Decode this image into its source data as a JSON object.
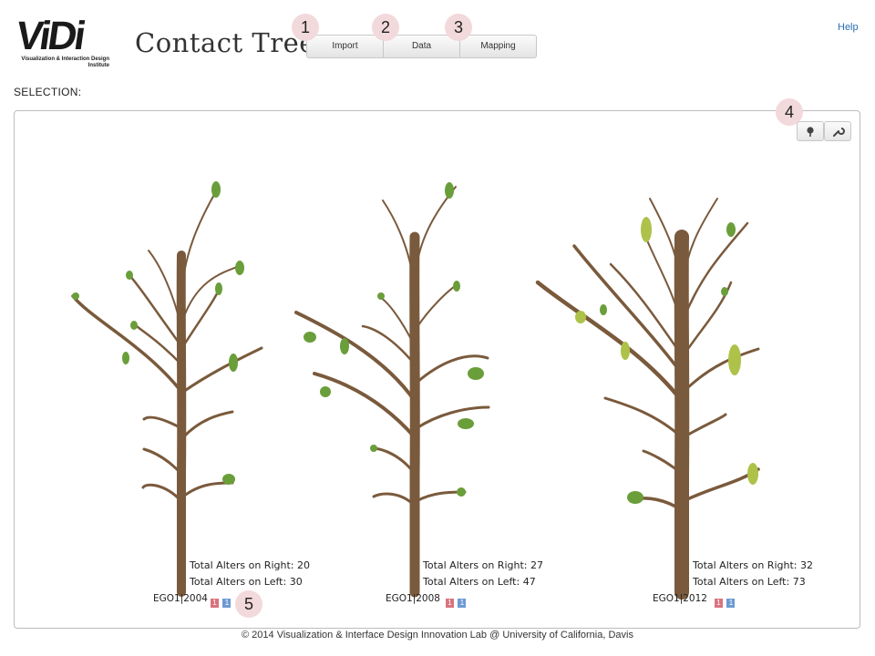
{
  "header": {
    "logo_text": "ViDi",
    "logo_subtitle": "Visualization & Interaction Design Institute",
    "app_title": "Contact Tree",
    "help_label": "Help"
  },
  "toolbar": {
    "buttons": [
      {
        "label": "Import",
        "badge": "1"
      },
      {
        "label": "Data",
        "badge": "2"
      },
      {
        "label": "Mapping",
        "badge": "3"
      }
    ]
  },
  "selection_label": "SELECTION:",
  "panel": {
    "tools_badge": "4",
    "ego_badge": "5",
    "tool_icons": [
      "tree-icon",
      "wrench-icon"
    ]
  },
  "trees": [
    {
      "right_label": "Total Alters on Right: 20",
      "left_label": "Total Alters on Left: 30",
      "ego": "EGO1|2004",
      "mini_a": "1",
      "mini_b": "1"
    },
    {
      "right_label": "Total Alters on Right: 27",
      "left_label": "Total Alters on Left: 47",
      "ego": "EGO1|2008",
      "mini_a": "1",
      "mini_b": "1"
    },
    {
      "right_label": "Total Alters on Right: 32",
      "left_label": "Total Alters on Left: 73",
      "ego": "EGO1|2012",
      "mini_a": "1",
      "mini_b": "1"
    }
  ],
  "colors": {
    "trunk": "#7a5a3c",
    "leaf": "#6a9e3a",
    "leaf_yellow": "#aec24a",
    "badge": "#f2d9db"
  },
  "footer": "© 2014 Visualization & Interface Design Innovation Lab @ University of California, Davis"
}
